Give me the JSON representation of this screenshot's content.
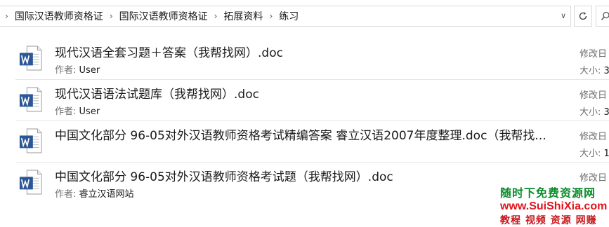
{
  "breadcrumb": {
    "items": [
      "国际汉语教师资格证",
      "国际汉语教师资格证",
      "拓展资料",
      "练习"
    ]
  },
  "files": [
    {
      "name": "现代汉语全套习题＋答案（我帮找网）.doc",
      "author_label": "作者:",
      "author": "User",
      "modified_label": "修改日",
      "size_label": "大小:",
      "size_value": "3"
    },
    {
      "name": "现代汉语语法试题库（我帮找网）.doc",
      "author_label": "作者:",
      "author": "User",
      "modified_label": "修改日",
      "size_label": "大小:",
      "size_value": "3"
    },
    {
      "name": "中国文化部分 96-05对外汉语教师资格考试精编答案 睿立汉语2007年度整理.doc（我帮找...",
      "modified_label": "修改日",
      "size_label": "大小:",
      "size_value": "1"
    },
    {
      "name": "中国文化部分 96-05对外汉语教师资格考试题（我帮找网）.doc",
      "author_label": "作者:",
      "author": "睿立汉语网站",
      "modified_label": "修改日"
    }
  ],
  "watermark": {
    "line1": "随时下免费资源网",
    "line2": "www.SuiShiXia.com",
    "line3": "教程 视频 资源 网赚"
  },
  "colors": {
    "word_blue": "#2b5797",
    "watermark_green": "#0a8c2a",
    "watermark_red": "#e0141c"
  }
}
